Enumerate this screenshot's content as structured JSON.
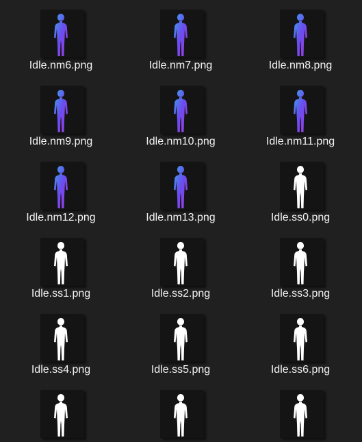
{
  "files": [
    {
      "name": "Idle.nm6.png",
      "kind": "normal-map"
    },
    {
      "name": "Idle.nm7.png",
      "kind": "normal-map"
    },
    {
      "name": "Idle.nm8.png",
      "kind": "normal-map"
    },
    {
      "name": "Idle.nm9.png",
      "kind": "normal-map"
    },
    {
      "name": "Idle.nm10.png",
      "kind": "normal-map"
    },
    {
      "name": "Idle.nm11.png",
      "kind": "normal-map"
    },
    {
      "name": "Idle.nm12.png",
      "kind": "normal-map"
    },
    {
      "name": "Idle.nm13.png",
      "kind": "normal-map"
    },
    {
      "name": "Idle.ss0.png",
      "kind": "silhouette"
    },
    {
      "name": "Idle.ss1.png",
      "kind": "silhouette"
    },
    {
      "name": "Idle.ss2.png",
      "kind": "silhouette"
    },
    {
      "name": "Idle.ss3.png",
      "kind": "silhouette"
    },
    {
      "name": "Idle.ss4.png",
      "kind": "silhouette"
    },
    {
      "name": "Idle.ss5.png",
      "kind": "silhouette"
    },
    {
      "name": "Idle.ss6.png",
      "kind": "silhouette"
    },
    {
      "name": "",
      "kind": "silhouette"
    },
    {
      "name": "",
      "kind": "silhouette"
    },
    {
      "name": "",
      "kind": "silhouette"
    }
  ],
  "colors": {
    "background": "#202020",
    "thumbnail_background": "#141414",
    "label_text": "#f2f2f2",
    "normal_map_gradient": [
      "#3aa8e8",
      "#6a4df0",
      "#a23be0"
    ],
    "silhouette": "#ffffff"
  }
}
